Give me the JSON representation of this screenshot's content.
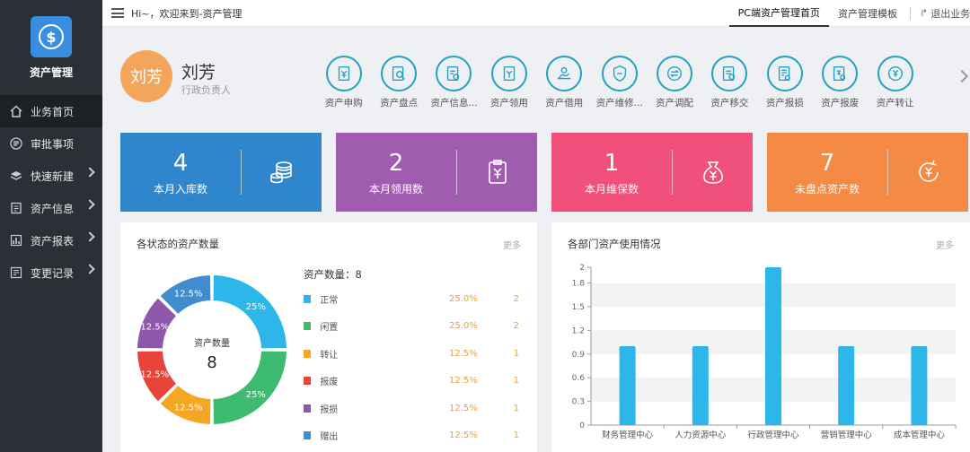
{
  "app": {
    "title": "资产管理",
    "logo_icon": "dollar-coin-icon"
  },
  "sidebar": {
    "items": [
      {
        "label": "业务首页",
        "icon": "home-icon",
        "active": true,
        "has_arrow": false
      },
      {
        "label": "审批事项",
        "icon": "list-icon",
        "active": false,
        "has_arrow": false
      },
      {
        "label": "快速新建",
        "icon": "layers-icon",
        "active": false,
        "has_arrow": true
      },
      {
        "label": "资产信息",
        "icon": "document-icon",
        "active": false,
        "has_arrow": true
      },
      {
        "label": "资产报表",
        "icon": "bar-chart-icon",
        "active": false,
        "has_arrow": true
      },
      {
        "label": "变更记录",
        "icon": "record-icon",
        "active": false,
        "has_arrow": true
      }
    ]
  },
  "topbar": {
    "welcome": "Hi~，欢迎来到-资产管理",
    "tabs": [
      {
        "label": "PC端资产管理首页",
        "active": true
      },
      {
        "label": "资产管理模板",
        "active": false
      }
    ],
    "logout": "退出业务"
  },
  "user": {
    "avatar_text": "刘芳",
    "name": "刘芳",
    "role": "行政负责人"
  },
  "quick_actions": [
    {
      "label": "资产申购",
      "icon": "purchase-icon"
    },
    {
      "label": "资产盘点",
      "icon": "inventory-icon"
    },
    {
      "label": "资产信息...",
      "icon": "info-icon"
    },
    {
      "label": "资产领用",
      "icon": "receive-icon"
    },
    {
      "label": "资产借用",
      "icon": "borrow-icon"
    },
    {
      "label": "资产维修...",
      "icon": "repair-icon"
    },
    {
      "label": "资产调配",
      "icon": "transfer-icon"
    },
    {
      "label": "资产移交",
      "icon": "handover-icon"
    },
    {
      "label": "资产报损",
      "icon": "damage-icon"
    },
    {
      "label": "资产报废",
      "icon": "scrap-icon"
    },
    {
      "label": "资产转让",
      "icon": "yen-transfer-icon"
    }
  ],
  "stats": [
    {
      "value": "4",
      "label": "本月入库数",
      "color": "#2f86cc",
      "icon": "coin-stack-icon"
    },
    {
      "value": "2",
      "label": "本月领用数",
      "color": "#a05db0",
      "icon": "clipboard-yen-icon"
    },
    {
      "value": "1",
      "label": "本月维保数",
      "color": "#f0507a",
      "icon": "money-bag-icon"
    },
    {
      "value": "7",
      "label": "未盘点资产数",
      "color": "#f58a45",
      "icon": "yen-cycle-icon"
    }
  ],
  "status_panel": {
    "title": "各状态的资产数量",
    "more": "更多",
    "center_label": "资产数量",
    "center_value": "8",
    "legend_title": "资产数量：8"
  },
  "dept_panel": {
    "title": "各部门资产使用情况",
    "more": "更多"
  },
  "chart_data": [
    {
      "type": "pie",
      "categories": [
        "正常",
        "闲置",
        "转让",
        "报废",
        "报损",
        "赠出"
      ],
      "values": [
        2,
        2,
        1,
        1,
        1,
        1
      ],
      "percent_labels": [
        "25.0%",
        "25.0%",
        "12.5%",
        "12.5%",
        "12.5%",
        "12.5%"
      ],
      "slice_labels": [
        "25%",
        "25%",
        "12.5%",
        "12.5%",
        "12.5%",
        "12.5%"
      ],
      "colors": [
        "#2db6ea",
        "#3dbb6e",
        "#f5a623",
        "#e8443a",
        "#8e58aa",
        "#3f8ccf"
      ]
    },
    {
      "type": "bar",
      "categories": [
        "财务管理中心",
        "人力资源中心",
        "行政管理中心",
        "营销管理中心",
        "成本管理中心"
      ],
      "values": [
        1,
        1,
        2,
        1,
        1
      ],
      "ylim": [
        0,
        2
      ],
      "yticks": [
        "0",
        "0.3",
        "0.6",
        "0.9",
        "1.2",
        "1.5",
        "1.8",
        "2"
      ],
      "color": "#2db6ea",
      "grid": true
    }
  ]
}
